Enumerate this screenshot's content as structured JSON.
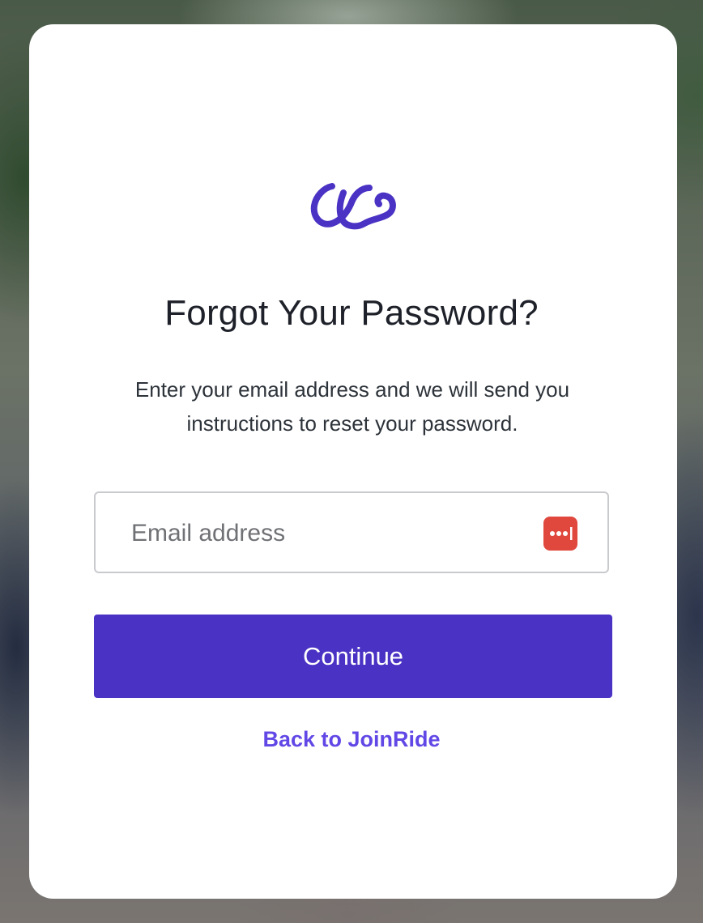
{
  "brand": {
    "logo_icon": "joinride-logo-icon",
    "accent_color": "#4a32c4",
    "link_color": "#6148e6"
  },
  "page": {
    "title": "Forgot Your Password?",
    "subtitle": "Enter your email address and we will send you instructions to reset your password."
  },
  "form": {
    "email_placeholder": "Email address",
    "email_value": "",
    "password_manager_icon": "password-manager-icon",
    "continue_label": "Continue",
    "back_link_label": "Back to JoinRide"
  }
}
